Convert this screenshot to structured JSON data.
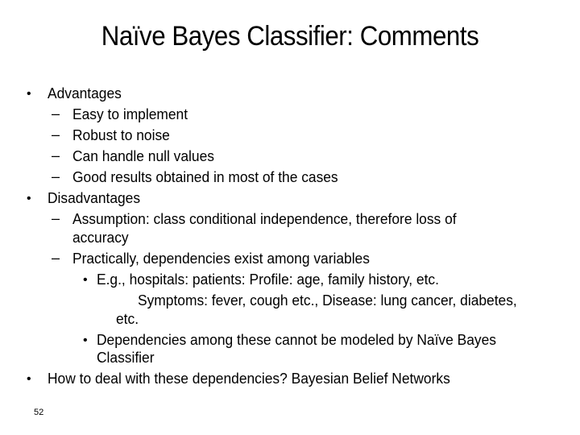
{
  "slide": {
    "title": "Naïve Bayes Classifier: Comments",
    "page_number": "52",
    "bullet_glyph": "•",
    "dash_glyph": "–",
    "advantages": {
      "heading": "Advantages",
      "items": [
        "Easy to implement",
        "Robust to noise",
        "Can handle null values",
        "Good results obtained in most of the cases"
      ]
    },
    "disadvantages": {
      "heading": "Disadvantages",
      "item1_line1": "Assumption: class conditional independence, therefore loss of",
      "item1_line2": "accuracy",
      "item2": "Practically, dependencies exist among variables",
      "example_line1": "E.g.,  hospitals: patients: Profile: age, family history, etc.",
      "example_line2": "Symptoms: fever, cough etc., Disease: lung cancer, diabetes,",
      "example_line3": "etc.",
      "limitation_line1": "Dependencies among these cannot be modeled by Naïve Bayes",
      "limitation_line2": "Classifier"
    },
    "solution": "How to deal with these dependencies? Bayesian Belief Networks"
  }
}
